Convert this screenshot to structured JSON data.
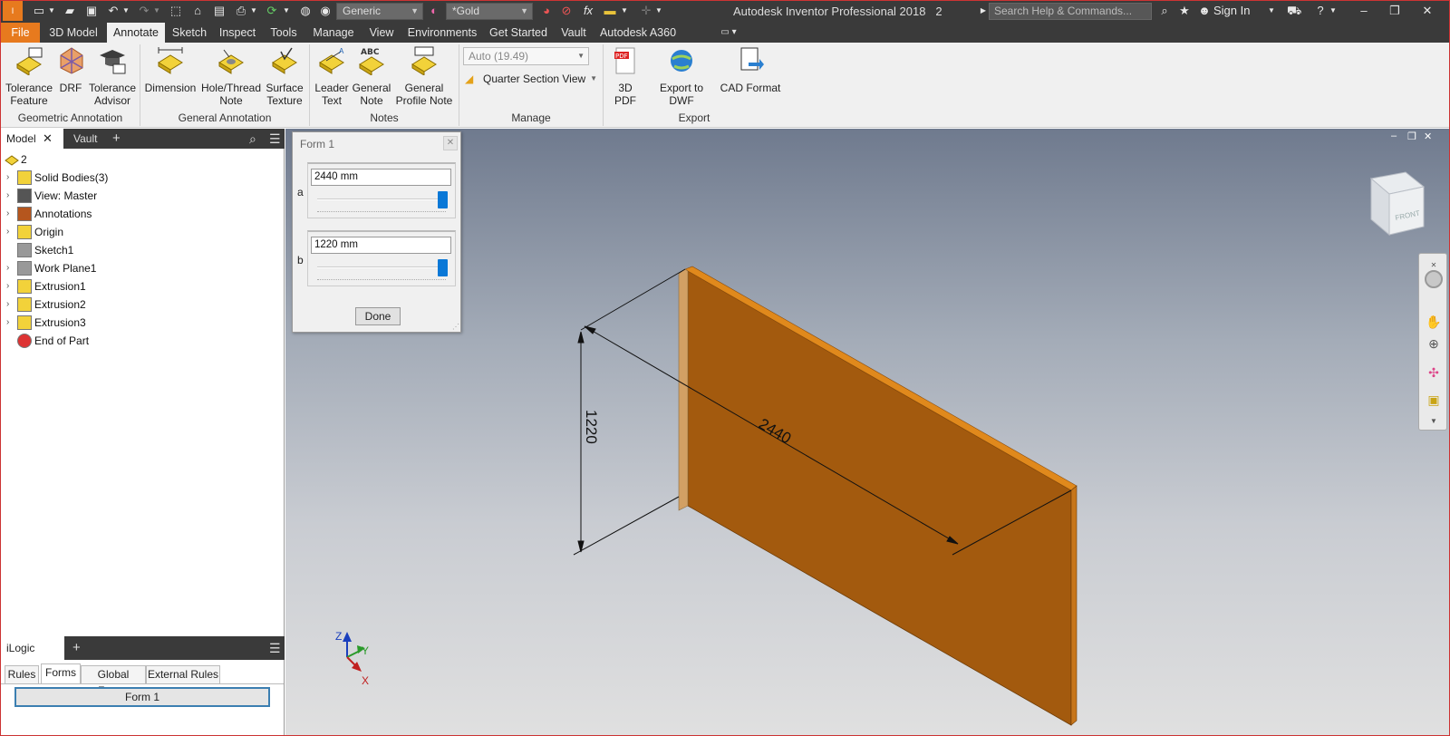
{
  "app_title": "Autodesk Inventor Professional 2018",
  "doc_name": "2",
  "appearance_dropdown": "Generic",
  "material_dropdown": "*Gold",
  "search_placeholder": "Search Help & Commands...",
  "sign_in": "Sign In",
  "menu_tabs": [
    "File",
    "3D Model",
    "Annotate",
    "Sketch",
    "Inspect",
    "Tools",
    "Manage",
    "View",
    "Environments",
    "Get Started",
    "Vault",
    "Autodesk A360"
  ],
  "active_tab": "Annotate",
  "ribbon": {
    "geometric": {
      "title": "Geometric Annotation",
      "buttons": [
        "Tolerance\nFeature",
        "DRF",
        "Tolerance\nAdvisor"
      ]
    },
    "general": {
      "title": "General Annotation",
      "buttons": [
        "Dimension",
        "Hole/Thread\nNote",
        "Surface\nTexture"
      ]
    },
    "notes": {
      "title": "Notes",
      "buttons": [
        "Leader\nText",
        "General\nNote",
        "General\nProfile Note"
      ]
    },
    "manage": {
      "title": "Manage",
      "scale_dropdown": "Auto (19.49)",
      "section_view": "Quarter Section View"
    },
    "export": {
      "title": "Export",
      "buttons": [
        "3D PDF",
        "Export to DWF",
        "CAD Format"
      ]
    }
  },
  "browser": {
    "tabs": [
      "Model",
      "Vault"
    ],
    "root": "2",
    "items": [
      {
        "label": "Solid Bodies(3)",
        "expandable": true
      },
      {
        "label": "View: Master",
        "expandable": true
      },
      {
        "label": "Annotations",
        "expandable": true
      },
      {
        "label": "Origin",
        "expandable": true
      },
      {
        "label": "Sketch1",
        "expandable": false
      },
      {
        "label": "Work Plane1",
        "expandable": true
      },
      {
        "label": "Extrusion1",
        "expandable": true
      },
      {
        "label": "Extrusion2",
        "expandable": true
      },
      {
        "label": "Extrusion3",
        "expandable": true
      },
      {
        "label": "End of Part",
        "expandable": false
      }
    ]
  },
  "ilogic": {
    "title": "iLogic",
    "tabs": [
      "Rules",
      "Forms",
      "Global Forms",
      "External Rules"
    ],
    "active_tab": "Forms",
    "form_button": "Form 1"
  },
  "form_dialog": {
    "title": "Form 1",
    "param_a": {
      "label": "a",
      "value": "2440 mm",
      "slider_fraction": 1.0
    },
    "param_b": {
      "label": "b",
      "value": "1220 mm",
      "slider_fraction": 1.0
    },
    "done": "Done"
  },
  "model": {
    "dim_width": "2440",
    "dim_height": "1220",
    "face_color": "#a35a0e",
    "top_color": "#e0891c",
    "side_color": "#d2a064"
  },
  "viewcube": {
    "label": "FRONT"
  },
  "triad": {
    "x": "X",
    "y": "Y",
    "z": "Z"
  }
}
